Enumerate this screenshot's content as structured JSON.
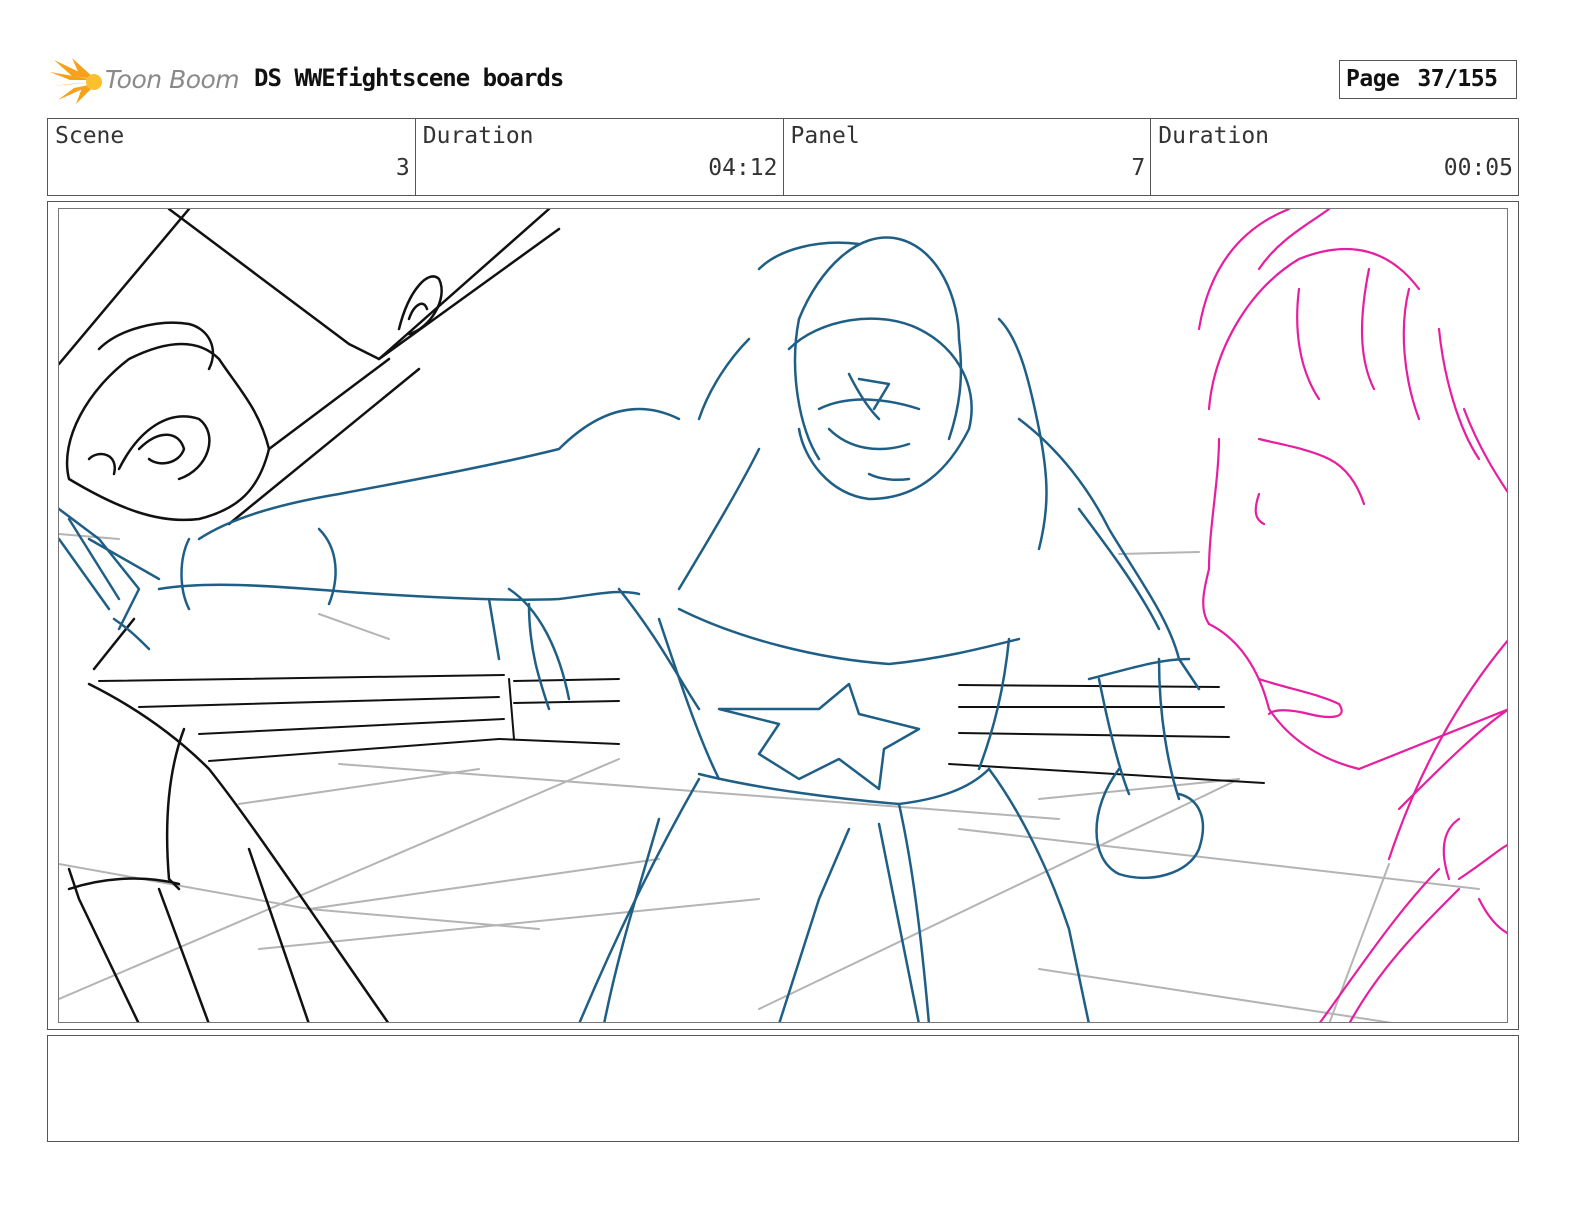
{
  "header": {
    "logo_text": "Toon Boom",
    "title": "DS WWEfightscene boards",
    "page_label": "Page",
    "page_number": "37/155"
  },
  "info": {
    "scene_label": "Scene",
    "scene_value": "3",
    "scene_duration_label": "Duration",
    "scene_duration_value": "04:12",
    "panel_label": "Panel",
    "panel_value": "7",
    "panel_duration_label": "Duration",
    "panel_duration_value": "00:05"
  },
  "colors": {
    "sketch_black": "#111111",
    "sketch_blue": "#1f5f86",
    "sketch_magenta": "#e61ea0",
    "sketch_gray": "#b4b4b4",
    "logo_orange": "#f5a21a"
  },
  "notes": ""
}
